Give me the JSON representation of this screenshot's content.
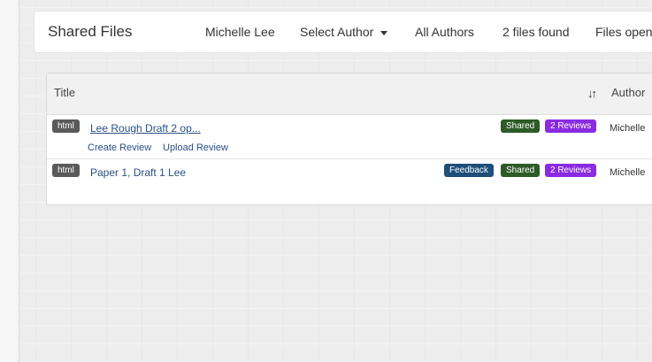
{
  "navbar": {
    "brand": "Shared Files",
    "user_name": "Michelle Lee",
    "select_author": "Select Author",
    "all_authors": "All Authors",
    "files_found": "2 files found",
    "files_open": "Files open"
  },
  "table": {
    "columns": {
      "title": "Title",
      "author": "Author",
      "sort_icon": "sort-icon"
    },
    "rows": [
      {
        "type": "html",
        "title": "Lee Rough Draft 2 op...",
        "actions": [
          "Create Review",
          "Upload Review"
        ],
        "badges": [
          {
            "label": "Shared",
            "color": "#2d5a27"
          },
          {
            "label": "2 Reviews",
            "color": "#8a2be2"
          }
        ],
        "author": "Michelle"
      },
      {
        "type": "html",
        "title": "Paper 1, Draft 1 Lee",
        "actions": [],
        "badges": [
          {
            "label": "Feedback",
            "color": "#1f4e79"
          },
          {
            "label": "Shared",
            "color": "#2d5a27"
          },
          {
            "label": "2 Reviews",
            "color": "#8a2be2"
          }
        ],
        "author": "Michelle"
      }
    ]
  }
}
